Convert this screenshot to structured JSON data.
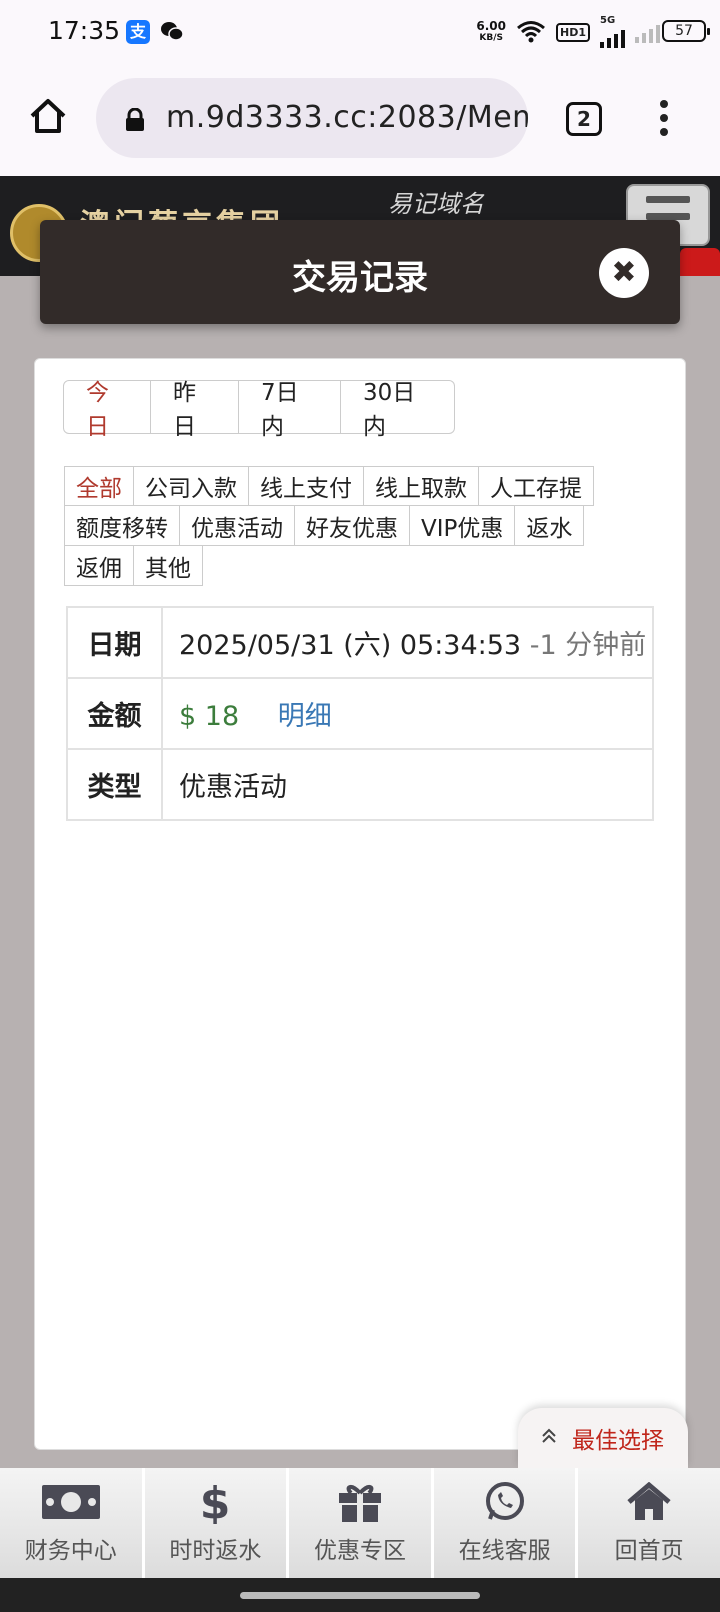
{
  "status_bar": {
    "time": "17:35",
    "alipay_glyph": "支",
    "net_speed_value": "6.00",
    "net_speed_unit": "KB/S",
    "hd_label": "HD1",
    "network_label": "5G",
    "battery": "57"
  },
  "browser": {
    "url": "m.9d3333.cc:2083/Mem",
    "tab_count": "2"
  },
  "site": {
    "name": "澳门葡京集团",
    "slogan": "易记域名"
  },
  "modal": {
    "title": "交易记录",
    "close_glyph": "✖"
  },
  "date_filters": [
    {
      "label": "今日",
      "active": true
    },
    {
      "label": "昨日",
      "active": false
    },
    {
      "label": "7日内",
      "active": false
    },
    {
      "label": "30日内",
      "active": false
    }
  ],
  "type_filters": {
    "row1": [
      "全部",
      "公司入款",
      "线上支付",
      "线上取款",
      "人工存提"
    ],
    "row2": [
      "额度移转",
      "优惠活动",
      "好友优惠",
      "VIP优惠",
      "返水"
    ],
    "row3": [
      "返佣",
      "其他"
    ]
  },
  "record": {
    "date_label": "日期",
    "date_value": "2025/05/31 (六) 05:34:53",
    "date_relative": "-1 分钟前",
    "amount_label": "金额",
    "amount_value": "$ 18",
    "detail_link": "明细",
    "type_label": "类型",
    "type_value": "优惠活动"
  },
  "best_choice": {
    "label": "最佳选择"
  },
  "bottom_nav": [
    "财务中心",
    "时时返水",
    "优惠专区",
    "在线客服",
    "回首页"
  ],
  "colors": {
    "accent_red": "#b03a2e",
    "amount_green": "#3c7d3c",
    "link_blue": "#3a78b5",
    "modal_header": "#322b29"
  }
}
